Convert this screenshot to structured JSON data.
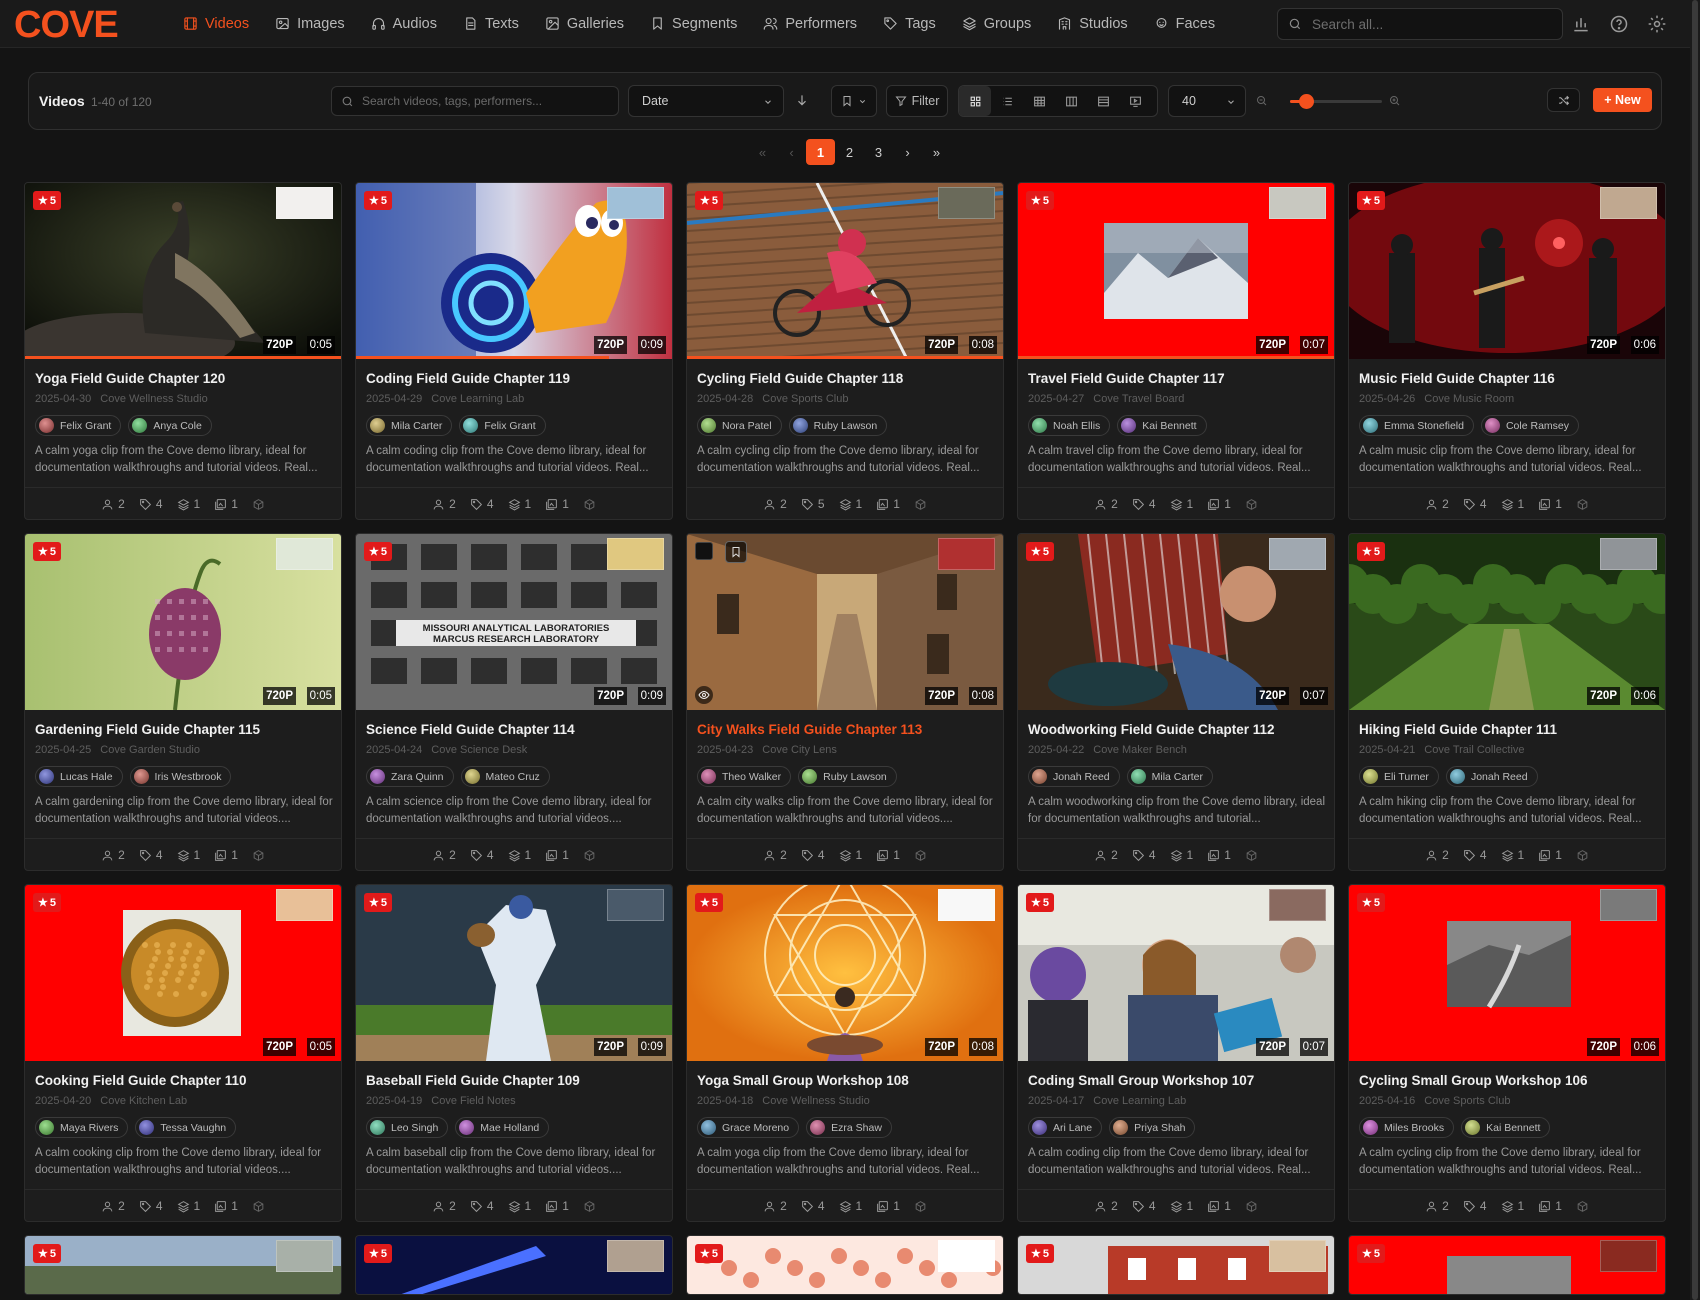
{
  "app": {
    "logo": "COVE",
    "brand_color": "#f4511e"
  },
  "nav": {
    "items": [
      {
        "label": "Videos",
        "icon": "film-icon",
        "active": true
      },
      {
        "label": "Images",
        "icon": "image-icon"
      },
      {
        "label": "Audios",
        "icon": "headphones-icon"
      },
      {
        "label": "Texts",
        "icon": "document-icon"
      },
      {
        "label": "Galleries",
        "icon": "gallery-icon"
      },
      {
        "label": "Segments",
        "icon": "bookmark-icon"
      },
      {
        "label": "Performers",
        "icon": "users-icon"
      },
      {
        "label": "Tags",
        "icon": "tag-icon"
      },
      {
        "label": "Groups",
        "icon": "layers-icon"
      },
      {
        "label": "Studios",
        "icon": "building-icon"
      },
      {
        "label": "Faces",
        "icon": "face-scan-icon"
      }
    ],
    "search_placeholder": "Search all..."
  },
  "toolbar": {
    "title": "Videos",
    "count": "1-40 of 120",
    "search_placeholder": "Search videos, tags, performers...",
    "sort_value": "Date",
    "filter_label": "Filter",
    "per_page": "40",
    "new_label": "+ New",
    "zoom_level": 0.17
  },
  "pagination": {
    "pages": [
      "1",
      "2",
      "3"
    ],
    "current": "1",
    "first": "«",
    "prev": "‹",
    "next": "›",
    "last": "»"
  },
  "cards": [
    {
      "title": "Yoga Field Guide Chapter 120",
      "date": "2025-04-30",
      "studio": "Cove Wellness Studio",
      "performers": [
        "Felix Grant",
        "Anya Cole"
      ],
      "desc": "A calm yoga clip from the Cove demo library, ideal for documentation walkthroughs and tutorial videos. Real...",
      "rating": "5",
      "res": "720P",
      "dur": "0:05",
      "stats": [
        "2",
        "4",
        "1",
        "1"
      ],
      "progress": 1.0,
      "art": "bird"
    },
    {
      "title": "Coding Field Guide Chapter 119",
      "date": "2025-04-29",
      "studio": "Cove Learning Lab",
      "performers": [
        "Mila Carter",
        "Felix Grant"
      ],
      "desc": "A calm coding clip from the Cove demo library, ideal for documentation walkthroughs and tutorial videos. Real...",
      "rating": "5",
      "res": "720P",
      "dur": "0:09",
      "stats": [
        "2",
        "4",
        "1",
        "1"
      ],
      "progress": 0.8,
      "art": "snail"
    },
    {
      "title": "Cycling Field Guide Chapter 118",
      "date": "2025-04-28",
      "studio": "Cove Sports Club",
      "performers": [
        "Nora Patel",
        "Ruby Lawson"
      ],
      "desc": "A calm cycling clip from the Cove demo library, ideal for documentation walkthroughs and tutorial videos. Real...",
      "rating": "5",
      "res": "720P",
      "dur": "0:08",
      "stats": [
        "2",
        "5",
        "1",
        "1"
      ],
      "progress": 1.0,
      "art": "track"
    },
    {
      "title": "Travel Field Guide Chapter 117",
      "date": "2025-04-27",
      "studio": "Cove Travel Board",
      "performers": [
        "Noah Ellis",
        "Kai Bennett"
      ],
      "desc": "A calm travel clip from the Cove demo library, ideal for documentation walkthroughs and tutorial videos. Real...",
      "rating": "5",
      "res": "720P",
      "dur": "0:07",
      "stats": [
        "2",
        "4",
        "1",
        "1"
      ],
      "progress": 1.0,
      "art": "redmount"
    },
    {
      "title": "Music Field Guide Chapter 116",
      "date": "2025-04-26",
      "studio": "Cove Music Room",
      "performers": [
        "Emma Stonefield",
        "Cole Ramsey"
      ],
      "desc": "A calm music clip from the Cove demo library, ideal for documentation walkthroughs and tutorial videos. Real...",
      "rating": "5",
      "res": "720P",
      "dur": "0:06",
      "stats": [
        "2",
        "4",
        "1",
        "1"
      ],
      "progress": 0,
      "art": "concert"
    },
    {
      "title": "Gardening Field Guide Chapter 115",
      "date": "2025-04-25",
      "studio": "Cove Garden Studio",
      "performers": [
        "Lucas Hale",
        "Iris Westbrook"
      ],
      "desc": "A calm gardening clip from the Cove demo library, ideal for documentation walkthroughs and tutorial videos....",
      "rating": "5",
      "res": "720P",
      "dur": "0:05",
      "stats": [
        "2",
        "4",
        "1",
        "1"
      ],
      "progress": 0,
      "art": "flower"
    },
    {
      "title": "Science Field Guide Chapter 114",
      "date": "2025-04-24",
      "studio": "Cove Science Desk",
      "performers": [
        "Zara Quinn",
        "Mateo Cruz"
      ],
      "desc": "A calm science clip from the Cove demo library, ideal for documentation walkthroughs and tutorial videos....",
      "rating": "5",
      "res": "720P",
      "dur": "0:09",
      "stats": [
        "2",
        "4",
        "1",
        "1"
      ],
      "progress": 0,
      "art": "building",
      "sign": [
        "MISSOURI ANALYTICAL LABORATORIES",
        "MARCUS RESEARCH LABORATORY"
      ]
    },
    {
      "title": "City Walks Field Guide Chapter 113",
      "date": "2025-04-23",
      "studio": "Cove City Lens",
      "performers": [
        "Theo Walker",
        "Ruby Lawson"
      ],
      "desc": "A calm city walks clip from the Cove demo library, ideal for documentation walkthroughs and tutorial videos....",
      "rating": "",
      "res": "720P",
      "dur": "0:08",
      "stats": [
        "2",
        "4",
        "1",
        "1"
      ],
      "progress": 0,
      "art": "alley",
      "hover": true
    },
    {
      "title": "Woodworking Field Guide Chapter 112",
      "date": "2025-04-22",
      "studio": "Cove Maker Bench",
      "performers": [
        "Jonah Reed",
        "Mila Carter"
      ],
      "desc": "A calm woodworking clip from the Cove demo library, ideal for documentation walkthroughs and tutorial...",
      "rating": "5",
      "res": "720P",
      "dur": "0:07",
      "stats": [
        "2",
        "4",
        "1",
        "1"
      ],
      "progress": 0,
      "art": "wood"
    },
    {
      "title": "Hiking Field Guide Chapter 111",
      "date": "2025-04-21",
      "studio": "Cove Trail Collective",
      "performers": [
        "Eli Turner",
        "Jonah Reed"
      ],
      "desc": "A calm hiking clip from the Cove demo library, ideal for documentation walkthroughs and tutorial videos. Real...",
      "rating": "5",
      "res": "720P",
      "dur": "0:06",
      "stats": [
        "2",
        "4",
        "1",
        "1"
      ],
      "progress": 0,
      "art": "forest"
    },
    {
      "title": "Cooking Field Guide Chapter 110",
      "date": "2025-04-20",
      "studio": "Cove Kitchen Lab",
      "performers": [
        "Maya Rivers",
        "Tessa Vaughn"
      ],
      "desc": "A calm cooking clip from the Cove demo library, ideal for documentation walkthroughs and tutorial videos....",
      "rating": "5",
      "res": "720P",
      "dur": "0:05",
      "stats": [
        "2",
        "4",
        "1",
        "1"
      ],
      "progress": 0,
      "art": "redpot"
    },
    {
      "title": "Baseball Field Guide Chapter 109",
      "date": "2025-04-19",
      "studio": "Cove Field Notes",
      "performers": [
        "Leo Singh",
        "Mae Holland"
      ],
      "desc": "A calm baseball clip from the Cove demo library, ideal for documentation walkthroughs and tutorial videos....",
      "rating": "5",
      "res": "720P",
      "dur": "0:09",
      "stats": [
        "2",
        "4",
        "1",
        "1"
      ],
      "progress": 0,
      "art": "baseball"
    },
    {
      "title": "Yoga Small Group Workshop 108",
      "date": "2025-04-18",
      "studio": "Cove Wellness Studio",
      "performers": [
        "Grace Moreno",
        "Ezra Shaw"
      ],
      "desc": "A calm yoga clip from the Cove demo library, ideal for documentation walkthroughs and tutorial videos. Real...",
      "rating": "5",
      "res": "720P",
      "dur": "0:08",
      "stats": [
        "2",
        "4",
        "1",
        "1"
      ],
      "progress": 0,
      "art": "mandala"
    },
    {
      "title": "Coding Small Group Workshop 107",
      "date": "2025-04-17",
      "studio": "Cove Learning Lab",
      "performers": [
        "Ari Lane",
        "Priya Shah"
      ],
      "desc": "A calm coding clip from the Cove demo library, ideal for documentation walkthroughs and tutorial videos. Real...",
      "rating": "5",
      "res": "720P",
      "dur": "0:07",
      "stats": [
        "2",
        "4",
        "1",
        "1"
      ],
      "progress": 0,
      "art": "class"
    },
    {
      "title": "Cycling Small Group Workshop 106",
      "date": "2025-04-16",
      "studio": "Cove Sports Club",
      "performers": [
        "Miles Brooks",
        "Kai Bennett"
      ],
      "desc": "A calm cycling clip from the Cove demo library, ideal for documentation walkthroughs and tutorial videos. Real...",
      "rating": "5",
      "res": "720P",
      "dur": "0:06",
      "stats": [
        "2",
        "4",
        "1",
        "1"
      ],
      "progress": 0,
      "art": "redroad"
    },
    {
      "rating": "5",
      "art": "field"
    },
    {
      "rating": "5",
      "art": "blue"
    },
    {
      "rating": "5",
      "art": "blossom"
    },
    {
      "rating": "5",
      "art": "house"
    },
    {
      "rating": "5",
      "art": "redscreen"
    }
  ]
}
